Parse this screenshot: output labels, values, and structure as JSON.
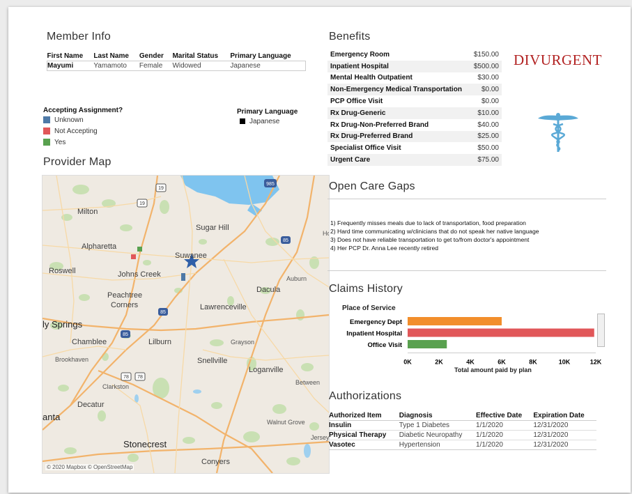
{
  "member_info": {
    "title": "Member Info",
    "columns": [
      "First Name",
      "Last Name",
      "Gender",
      "Marital Status",
      "Primary Language"
    ],
    "row": [
      "Mayumi",
      "Yamamoto",
      "Female",
      "Widowed",
      "Japanese"
    ]
  },
  "legend_assignment": {
    "title": "Accepting Assignment?",
    "items": [
      {
        "label": "Unknown",
        "color": "#4e79a7"
      },
      {
        "label": "Not Accepting",
        "color": "#e15759"
      },
      {
        "label": "Yes",
        "color": "#59a14f"
      }
    ]
  },
  "legend_language": {
    "title": "Primary Language",
    "items": [
      {
        "label": "Japanese",
        "color": "#000000"
      }
    ]
  },
  "provider_map": {
    "title": "Provider Map",
    "attribution": "© 2020 Mapbox © OpenStreetMap",
    "places": [
      "Milton",
      "Sugar Hill",
      "Alpharetta",
      "Suwanee",
      "Roswell",
      "Johns Creek",
      "Auburn",
      "Dacula",
      "Peachtree",
      "Corners",
      "Lawrenceville",
      "ly Springs",
      "Chamblee",
      "Lilburn",
      "Grayson",
      "Brookhaven",
      "Snellville",
      "Loganville",
      "Clarkston",
      "Between",
      "Decatur",
      "anta",
      "Walnut Grove",
      "Jersey",
      "Stonecrest",
      "Conyers",
      "Ho"
    ],
    "route_numbers": [
      "19",
      "19",
      "985",
      "85",
      "85",
      "85",
      "78",
      "78"
    ]
  },
  "benefits": {
    "title": "Benefits",
    "rows": [
      {
        "name": "Emergency Room",
        "value": "$150.00"
      },
      {
        "name": "Inpatient Hospital",
        "value": "$500.00"
      },
      {
        "name": "Mental Health Outpatient",
        "value": "$30.00"
      },
      {
        "name": "Non-Emergency Medical Transportation",
        "value": "$0.00"
      },
      {
        "name": "PCP Office Visit",
        "value": "$0.00"
      },
      {
        "name": "Rx Drug-Generic",
        "value": "$10.00"
      },
      {
        "name": "Rx Drug-Non-Preferred Brand",
        "value": "$40.00"
      },
      {
        "name": "Rx Drug-Preferred Brand",
        "value": "$25.00"
      },
      {
        "name": "Specialist Office Visit",
        "value": "$50.00"
      },
      {
        "name": "Urgent Care",
        "value": "$75.00"
      }
    ]
  },
  "brand": {
    "logo_text": "DIVURGENT",
    "logo_color": "#b22222",
    "caduceus_color": "#5aa9d6"
  },
  "care_gaps": {
    "title": "Open Care Gaps",
    "items": [
      "1) Frequently misses meals due to lack of transportation, food preparation",
      "2) Hard time communicating w/clinicians that do not speak her native language",
      "3) Does not have reliable transportation to get to/from doctor's appointment",
      "4) Her PCP Dr. Anna Lee recently retired"
    ]
  },
  "claims_history": {
    "title": "Claims History",
    "category_header": "Place of Service",
    "x_axis_title": "Total amount paid by plan",
    "tick_labels": [
      "0K",
      "2K",
      "4K",
      "6K",
      "8K",
      "10K",
      "12K"
    ]
  },
  "chart_data": {
    "type": "bar",
    "orientation": "horizontal",
    "categories": [
      "Emergency Dept",
      "Inpatient Hospital",
      "Office Visit"
    ],
    "values": [
      6000,
      11900,
      2500
    ],
    "colors": [
      "#f28e2b",
      "#e15759",
      "#59a14f"
    ],
    "xlabel": "Total amount paid by plan",
    "ylabel": "Place of Service",
    "xlim": [
      0,
      12000
    ],
    "xticks": [
      0,
      2000,
      4000,
      6000,
      8000,
      10000,
      12000
    ],
    "grid": false
  },
  "authorizations": {
    "title": "Authorizations",
    "columns": [
      "Authorized Item",
      "Diagnosis",
      "Effective Date",
      "Expiration Date"
    ],
    "rows": [
      [
        "Insulin",
        "Type 1 Diabetes",
        "1/1/2020",
        "12/31/2020"
      ],
      [
        "Physical Therapy",
        "Diabetic Neuropathy",
        "1/1/2020",
        "12/31/2020"
      ],
      [
        "Vasotec",
        "Hypertension",
        "1/1/2020",
        "12/31/2020"
      ]
    ]
  }
}
